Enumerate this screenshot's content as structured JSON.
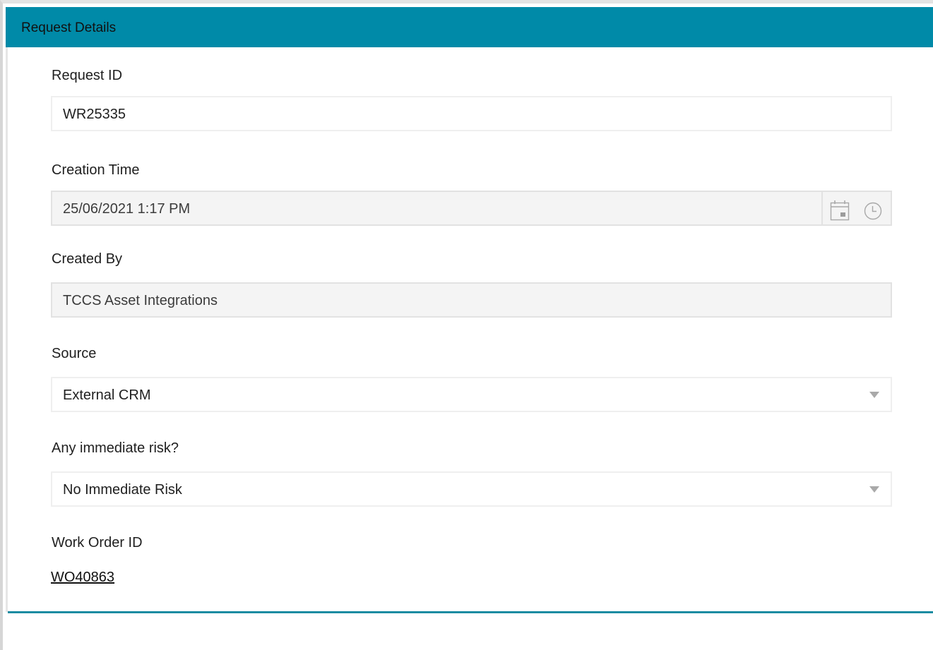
{
  "section": {
    "title": "Request Details"
  },
  "fields": {
    "request_id": {
      "label": "Request ID",
      "value": "WR25335"
    },
    "creation_time": {
      "label": "Creation Time",
      "value": "25/06/2021 1:17 PM"
    },
    "created_by": {
      "label": "Created By",
      "value": "TCCS Asset Integrations"
    },
    "source": {
      "label": "Source",
      "value": "External CRM"
    },
    "immediate_risk": {
      "label": "Any immediate risk?",
      "value": "No Immediate Risk"
    },
    "work_order_id": {
      "label": "Work Order ID",
      "value": "WO40863"
    }
  },
  "icons": {
    "calendar": "calendar-icon",
    "clock": "clock-icon",
    "dropdown": "chevron-down-icon"
  },
  "colors": {
    "header": "#008aa8",
    "accent_rule": "#1b8ba2",
    "readonly_bg": "#f4f4f4"
  }
}
